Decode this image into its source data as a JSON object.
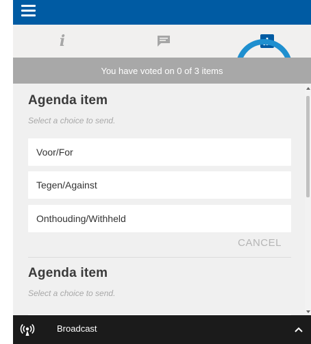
{
  "header": {
    "menu_icon": "hamburger-menu-icon"
  },
  "tabs": [
    {
      "name": "info",
      "icon": "info-icon",
      "glyph": "i"
    },
    {
      "name": "chat",
      "icon": "chat-bubble-icon"
    },
    {
      "name": "vote",
      "icon": "bar-chart-icon",
      "active": true
    }
  ],
  "colors": {
    "brand_blue": "#005ba3",
    "highlight_ring": "#1f8fcf",
    "status_bar": "#a8a8a8",
    "bottom_bar": "#1b1b1b"
  },
  "vote_status": "You have voted on 0 of 3 items",
  "agenda_items": [
    {
      "title": "Agenda item",
      "hint": "Select a choice to send.",
      "choices": [
        "Voor/For",
        "Tegen/Against",
        "Onthouding/Withheld"
      ],
      "cancel_label": "CANCEL"
    },
    {
      "title": "Agenda item",
      "hint": "Select a choice to send."
    }
  ],
  "bottom_bar": {
    "icon": "broadcast-icon",
    "label": "Broadcast",
    "toggle_icon": "chevron-up-icon"
  }
}
